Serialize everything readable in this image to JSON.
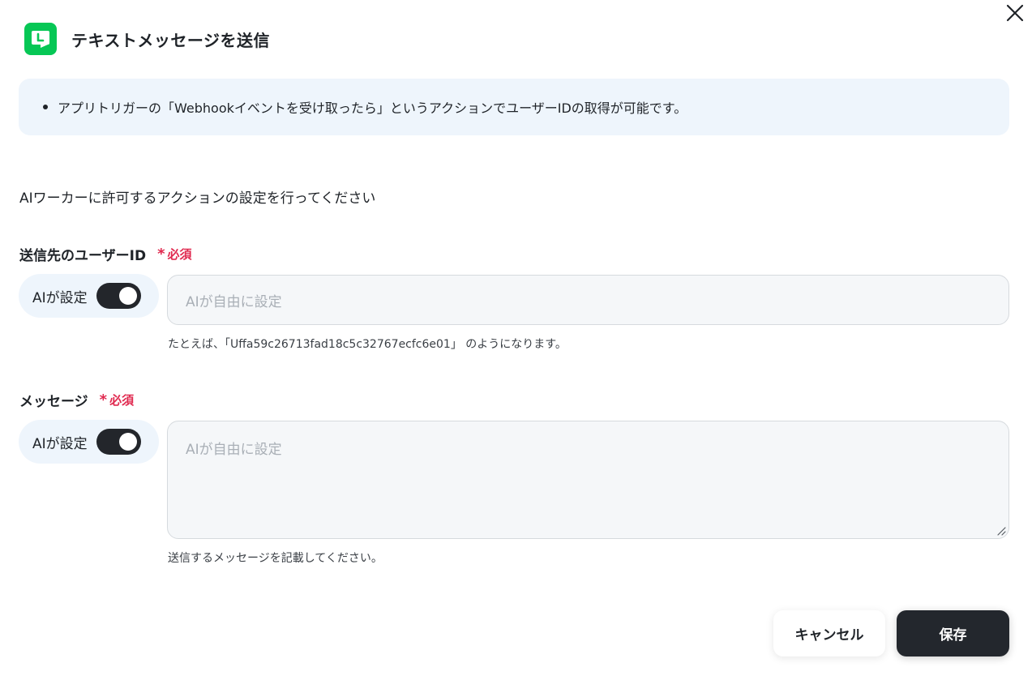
{
  "dialog": {
    "title": "テキストメッセージを送信",
    "app_icon": "line-icon",
    "close_icon": "close-icon"
  },
  "info": {
    "text": "アプリトリガーの「Webhookイベントを受け取ったら」というアクションでユーザーIDの取得が可能です。"
  },
  "intro": "AIワーカーに許可するアクションの設定を行ってください",
  "fields": [
    {
      "label": "送信先のユーザーID",
      "required_label": "必須",
      "ai_toggle_label": "AIが設定",
      "ai_toggle_on": true,
      "placeholder": "AIが自由に設定",
      "helper": "たとえば、「Uffa59c26713fad18c5c32767ecfc6e01」 のようになります。"
    },
    {
      "label": "メッセージ",
      "required_label": "必須",
      "ai_toggle_label": "AIが設定",
      "ai_toggle_on": true,
      "placeholder": "AIが自由に設定",
      "helper": "送信するメッセージを記載してください。"
    }
  ],
  "actions": {
    "cancel_label": "キャンセル",
    "save_label": "保存"
  },
  "colors": {
    "brand": "#06c755",
    "required": "#e0294f",
    "info_bg": "#eef5fc",
    "primary_button": "#23272d"
  }
}
